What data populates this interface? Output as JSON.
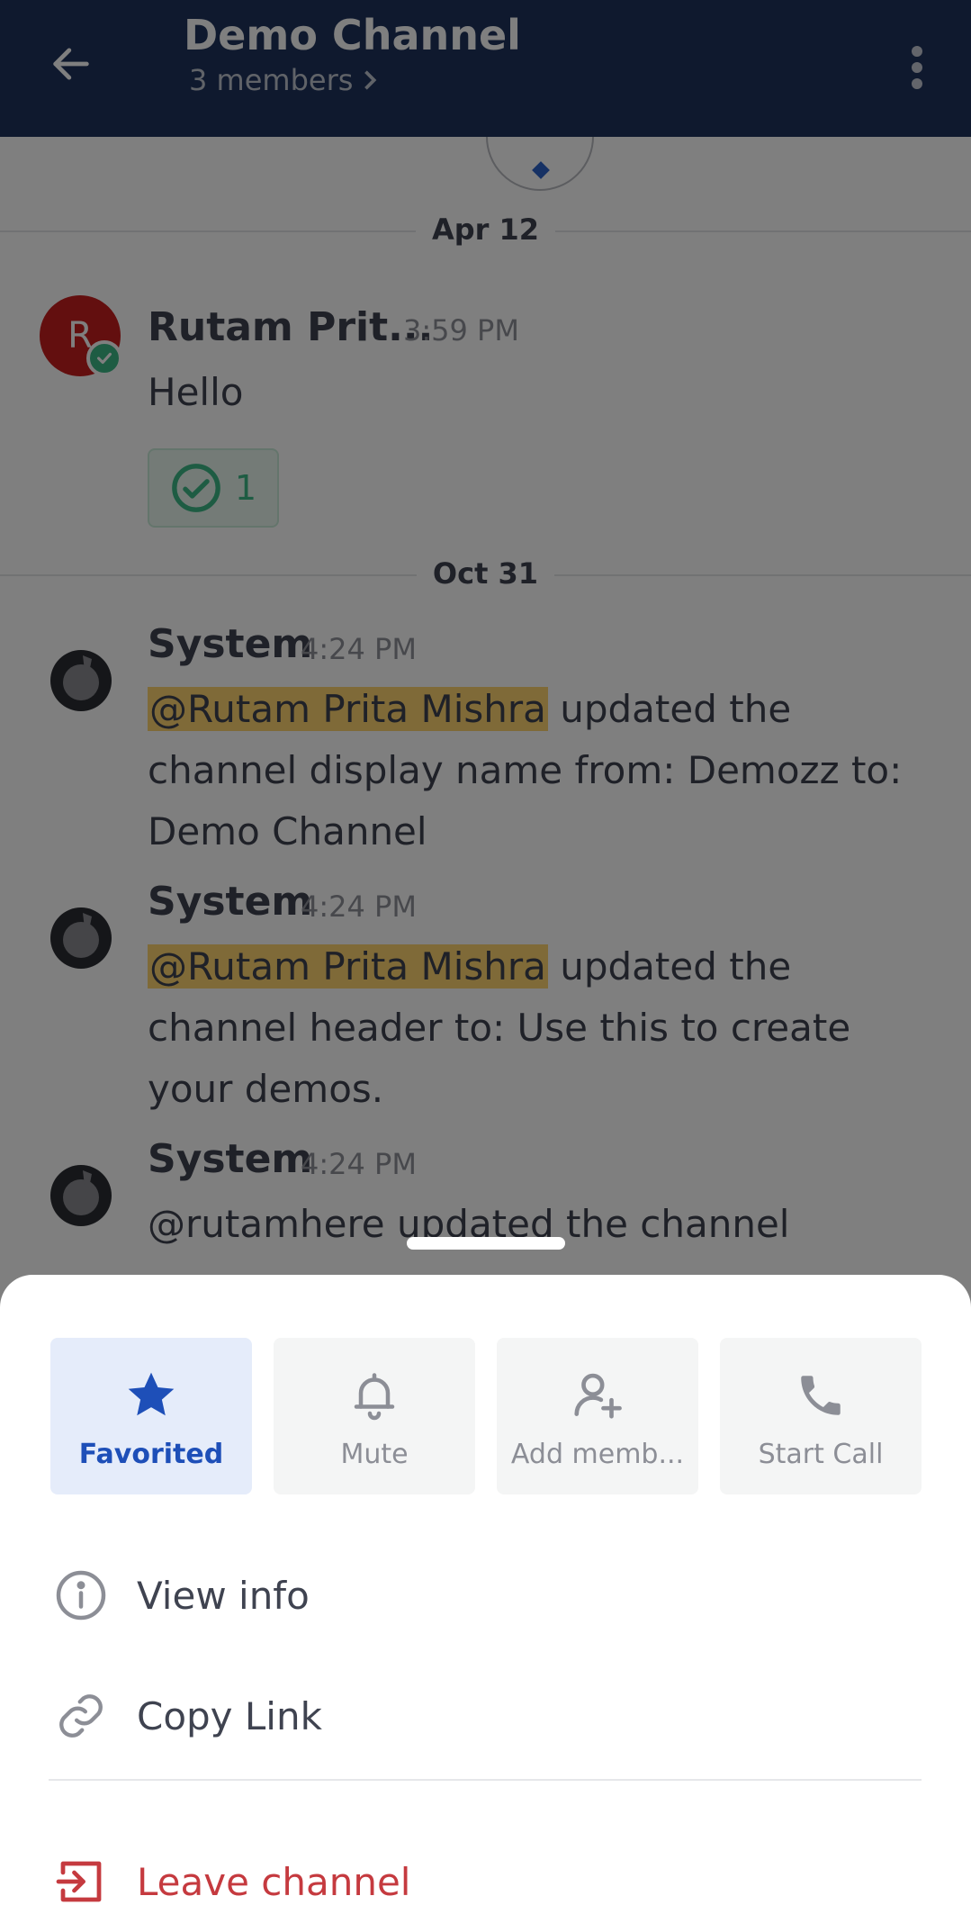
{
  "header": {
    "title": "Demo Channel",
    "subtitle": "3 members",
    "back_icon": "arrow-left-icon",
    "more_icon": "more-vertical-icon"
  },
  "chat": {
    "date_separators": [
      "Apr 12",
      "Oct 31"
    ],
    "messages": [
      {
        "author": "Rutam Prit...",
        "avatar_initial": "R",
        "time": "3:59 PM",
        "text": "Hello",
        "reaction_count": "1"
      },
      {
        "author": "System",
        "time": "4:24 PM",
        "mention": "@Rutam Prita Mishra",
        "text": " updated the channel display name from: Demozz to: Demo Channel"
      },
      {
        "author": "System",
        "time": "4:24 PM",
        "mention": "@Rutam Prita Mishra",
        "text": " updated the channel header to: Use this to create your demos."
      },
      {
        "author": "System",
        "time": "4:24 PM",
        "text": "@rutamhere updated the channel"
      }
    ]
  },
  "sheet": {
    "quick_actions": [
      {
        "label": "Favorited",
        "icon": "star-icon",
        "active": true
      },
      {
        "label": "Mute",
        "icon": "bell-icon",
        "active": false
      },
      {
        "label": "Add memb...",
        "icon": "add-member-icon",
        "active": false
      },
      {
        "label": "Start Call",
        "icon": "phone-icon",
        "active": false
      }
    ],
    "menu": [
      {
        "label": "View info",
        "icon": "info-icon"
      },
      {
        "label": "Copy Link",
        "icon": "link-icon"
      }
    ],
    "leave": {
      "label": "Leave channel",
      "icon": "leave-icon"
    }
  },
  "colors": {
    "header_bg": "#1e325c",
    "accent": "#1e4fb8",
    "danger": "#c53a3f",
    "mention_bg": "#ffd470",
    "online": "#3db887"
  }
}
